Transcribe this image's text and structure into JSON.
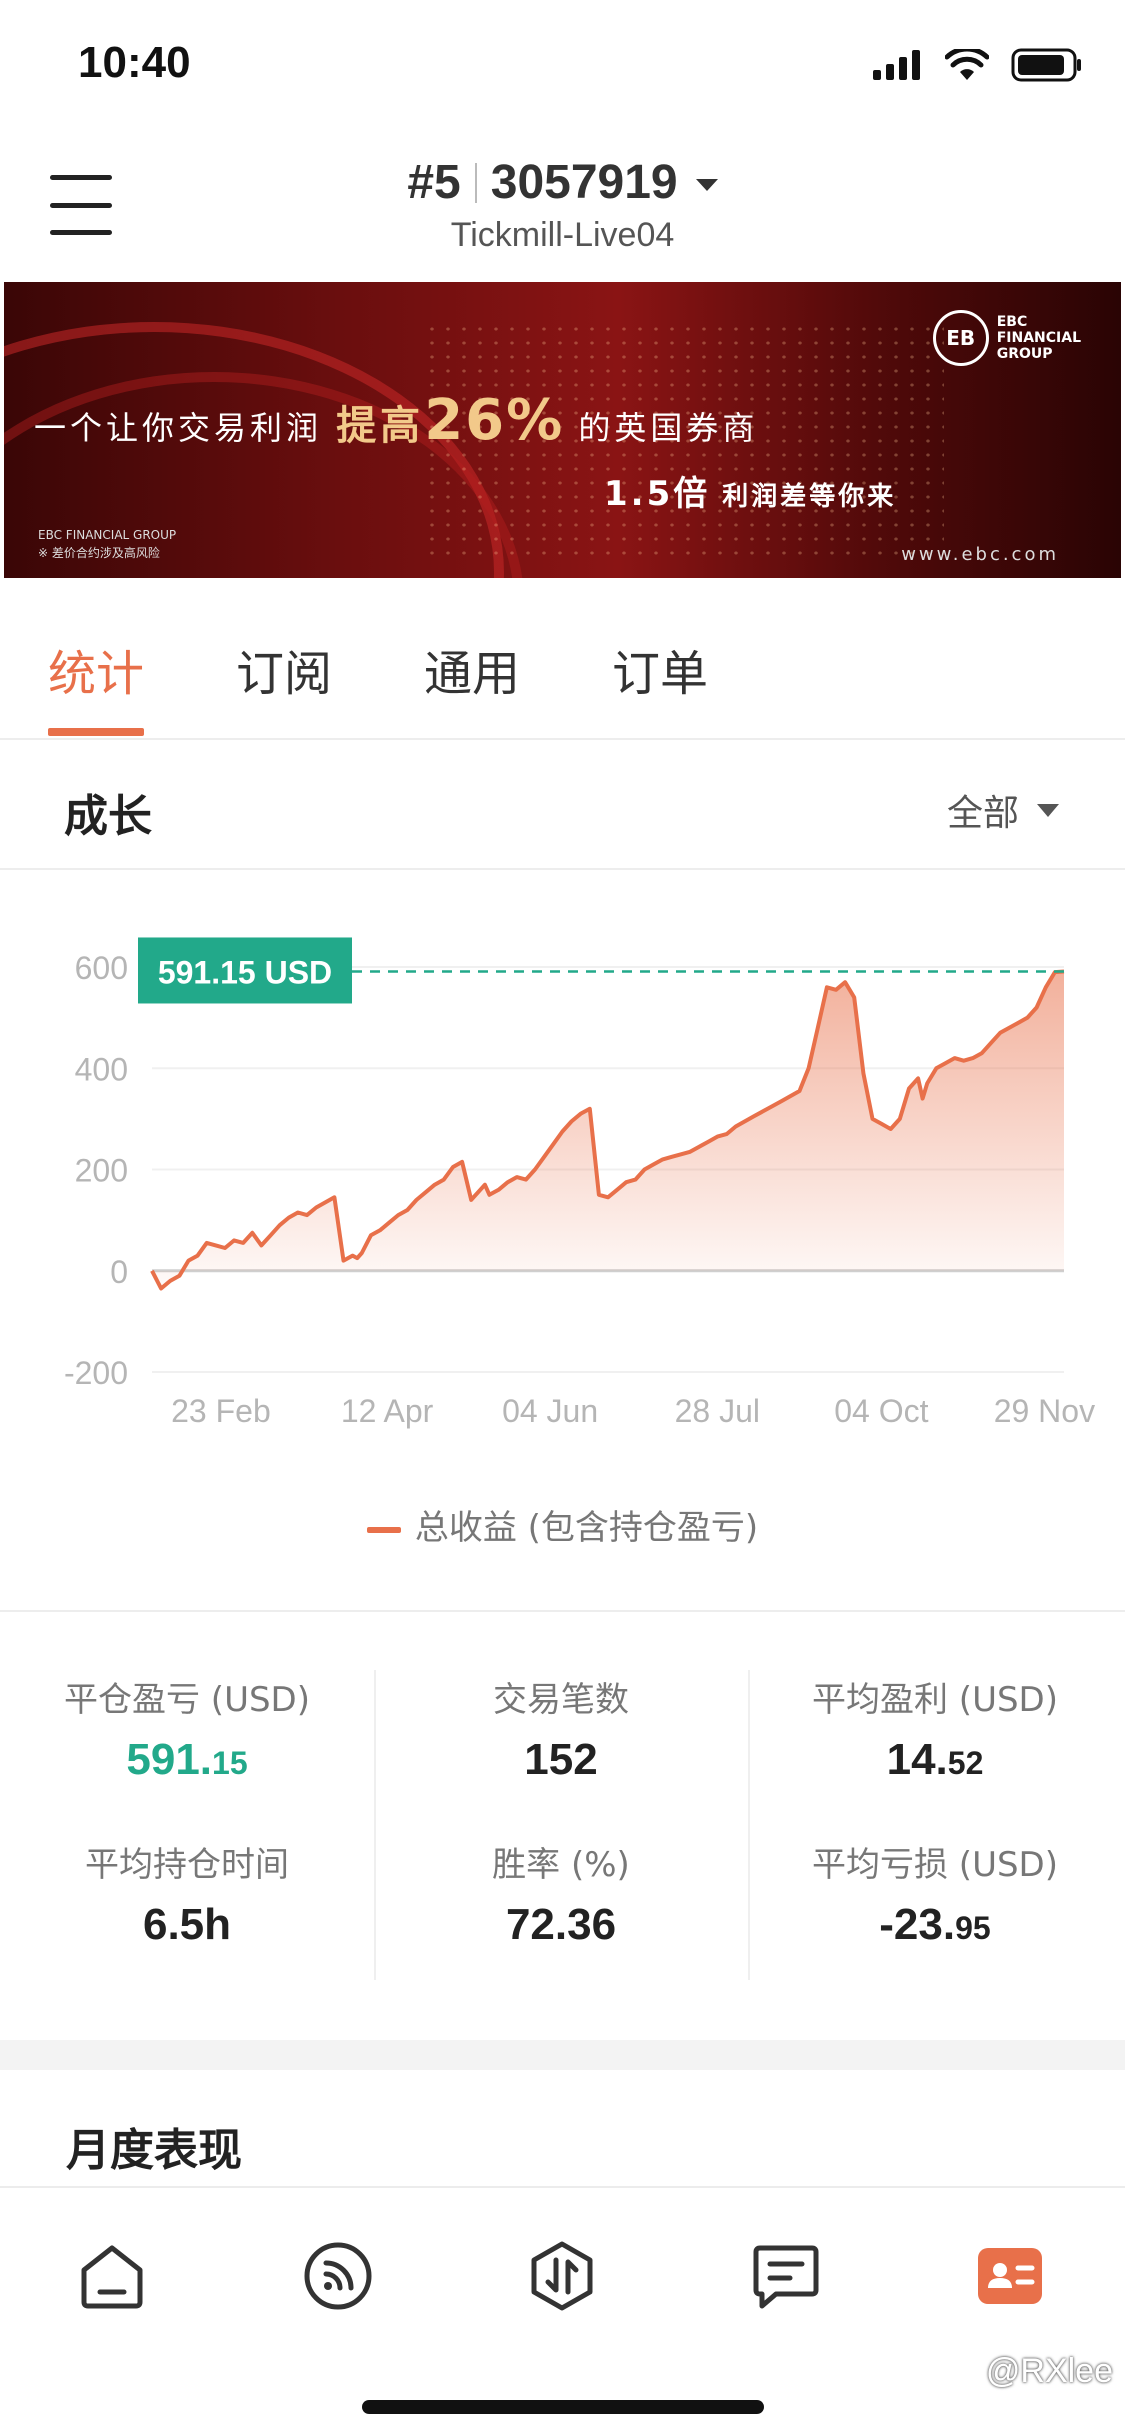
{
  "status_bar": {
    "time": "10:40"
  },
  "header": {
    "account_index": "#5",
    "account_number": "3057919",
    "server": "Tickmill-Live04"
  },
  "banner": {
    "text_before": "一个让你交易利润",
    "text_highlight": "提高",
    "text_percent": "26%",
    "text_after": "的英国券商",
    "sub_number": "1.5倍",
    "sub_text": "利润差等你来",
    "logo_text_1": "EBC",
    "logo_text_2": "FINANCIAL",
    "logo_text_3": "GROUP",
    "url": "www.ebc.com",
    "corner_1": "EBC FINANCIAL GROUP",
    "corner_2": "※ 差价合约涉及高风险"
  },
  "tabs": [
    {
      "label": "统计",
      "active": true
    },
    {
      "label": "订阅",
      "active": false
    },
    {
      "label": "通用",
      "active": false
    },
    {
      "label": "订单",
      "active": false
    }
  ],
  "growth": {
    "title": "成长",
    "range_label": "全部"
  },
  "chart_data": {
    "type": "area",
    "y_ticks": [
      "600",
      "400",
      "200",
      "0",
      "-200"
    ],
    "ylim": [
      -200,
      600
    ],
    "x_tick_labels": [
      "23 Feb",
      "12 Apr",
      "04 Jun",
      "28 Jul",
      "04 Oct",
      "29 Nov"
    ],
    "x_tick_positions": [
      0.154,
      0.313,
      0.469,
      0.629,
      0.786,
      0.942
    ],
    "current_value_label": "591.15 USD",
    "current_value": 591.15,
    "legend": "总收益 (包含持仓盈亏)",
    "colors": {
      "line": "#e8704a",
      "badge": "#22a98a",
      "dashed": "#22a98a"
    },
    "series": [
      {
        "name": "总收益 (包含持仓盈亏)",
        "x": [
          0,
          0.01,
          0.02,
          0.03,
          0.04,
          0.05,
          0.06,
          0.07,
          0.08,
          0.09,
          0.1,
          0.11,
          0.12,
          0.13,
          0.14,
          0.15,
          0.16,
          0.17,
          0.18,
          0.19,
          0.2,
          0.21,
          0.22,
          0.225,
          0.23,
          0.24,
          0.25,
          0.26,
          0.27,
          0.28,
          0.29,
          0.3,
          0.31,
          0.32,
          0.33,
          0.34,
          0.35,
          0.36,
          0.365,
          0.37,
          0.38,
          0.39,
          0.4,
          0.41,
          0.42,
          0.43,
          0.44,
          0.45,
          0.46,
          0.47,
          0.48,
          0.49,
          0.5,
          0.51,
          0.52,
          0.53,
          0.535,
          0.54,
          0.55,
          0.56,
          0.57,
          0.58,
          0.59,
          0.6,
          0.61,
          0.62,
          0.63,
          0.64,
          0.65,
          0.66,
          0.67,
          0.68,
          0.69,
          0.7,
          0.71,
          0.72,
          0.73,
          0.74,
          0.75,
          0.76,
          0.77,
          0.78,
          0.79,
          0.8,
          0.81,
          0.82,
          0.83,
          0.84,
          0.845,
          0.85,
          0.86,
          0.87,
          0.88,
          0.89,
          0.9,
          0.91,
          0.92,
          0.93,
          0.94,
          0.95,
          0.96,
          0.97,
          0.98,
          0.99,
          1.0
        ],
        "y": [
          0,
          -35,
          -20,
          -10,
          20,
          30,
          55,
          50,
          45,
          60,
          55,
          75,
          50,
          70,
          90,
          105,
          115,
          110,
          125,
          135,
          145,
          20,
          30,
          25,
          35,
          70,
          80,
          95,
          110,
          120,
          140,
          155,
          170,
          180,
          205,
          215,
          140,
          160,
          170,
          150,
          160,
          175,
          185,
          180,
          200,
          225,
          250,
          275,
          295,
          310,
          320,
          150,
          145,
          160,
          175,
          180,
          190,
          200,
          210,
          220,
          225,
          230,
          235,
          245,
          255,
          265,
          270,
          285,
          295,
          305,
          315,
          325,
          335,
          345,
          355,
          400,
          480,
          560,
          555,
          570,
          540,
          390,
          300,
          290,
          280,
          300,
          360,
          380,
          340,
          370,
          400,
          410,
          420,
          415,
          420,
          430,
          450,
          470,
          480,
          490,
          500,
          520,
          560,
          590,
          591.15
        ]
      }
    ]
  },
  "stats": [
    {
      "label": "平仓盈亏 (USD)",
      "int": "591.",
      "dec": "15",
      "green": true
    },
    {
      "label": "交易笔数",
      "int": "152",
      "dec": "",
      "green": false
    },
    {
      "label": "平均盈利 (USD)",
      "int": "14.",
      "dec": "52",
      "green": false
    },
    {
      "label": "平均持仓时间",
      "int": "6.5h",
      "dec": "",
      "green": false
    },
    {
      "label": "胜率 (%)",
      "int": "72.36",
      "dec": "",
      "green": false
    },
    {
      "label": "平均亏损 (USD)",
      "int": "-23.",
      "dec": "95",
      "green": false
    }
  ],
  "monthly": {
    "title": "月度表现"
  },
  "bottom_nav": [
    {
      "icon": "home-icon",
      "active": false
    },
    {
      "icon": "signal-feed-icon",
      "active": false
    },
    {
      "icon": "trade-icon",
      "active": false
    },
    {
      "icon": "message-icon",
      "active": false
    },
    {
      "icon": "profile-card-icon",
      "active": true
    }
  ],
  "watermark": "@RXlee"
}
